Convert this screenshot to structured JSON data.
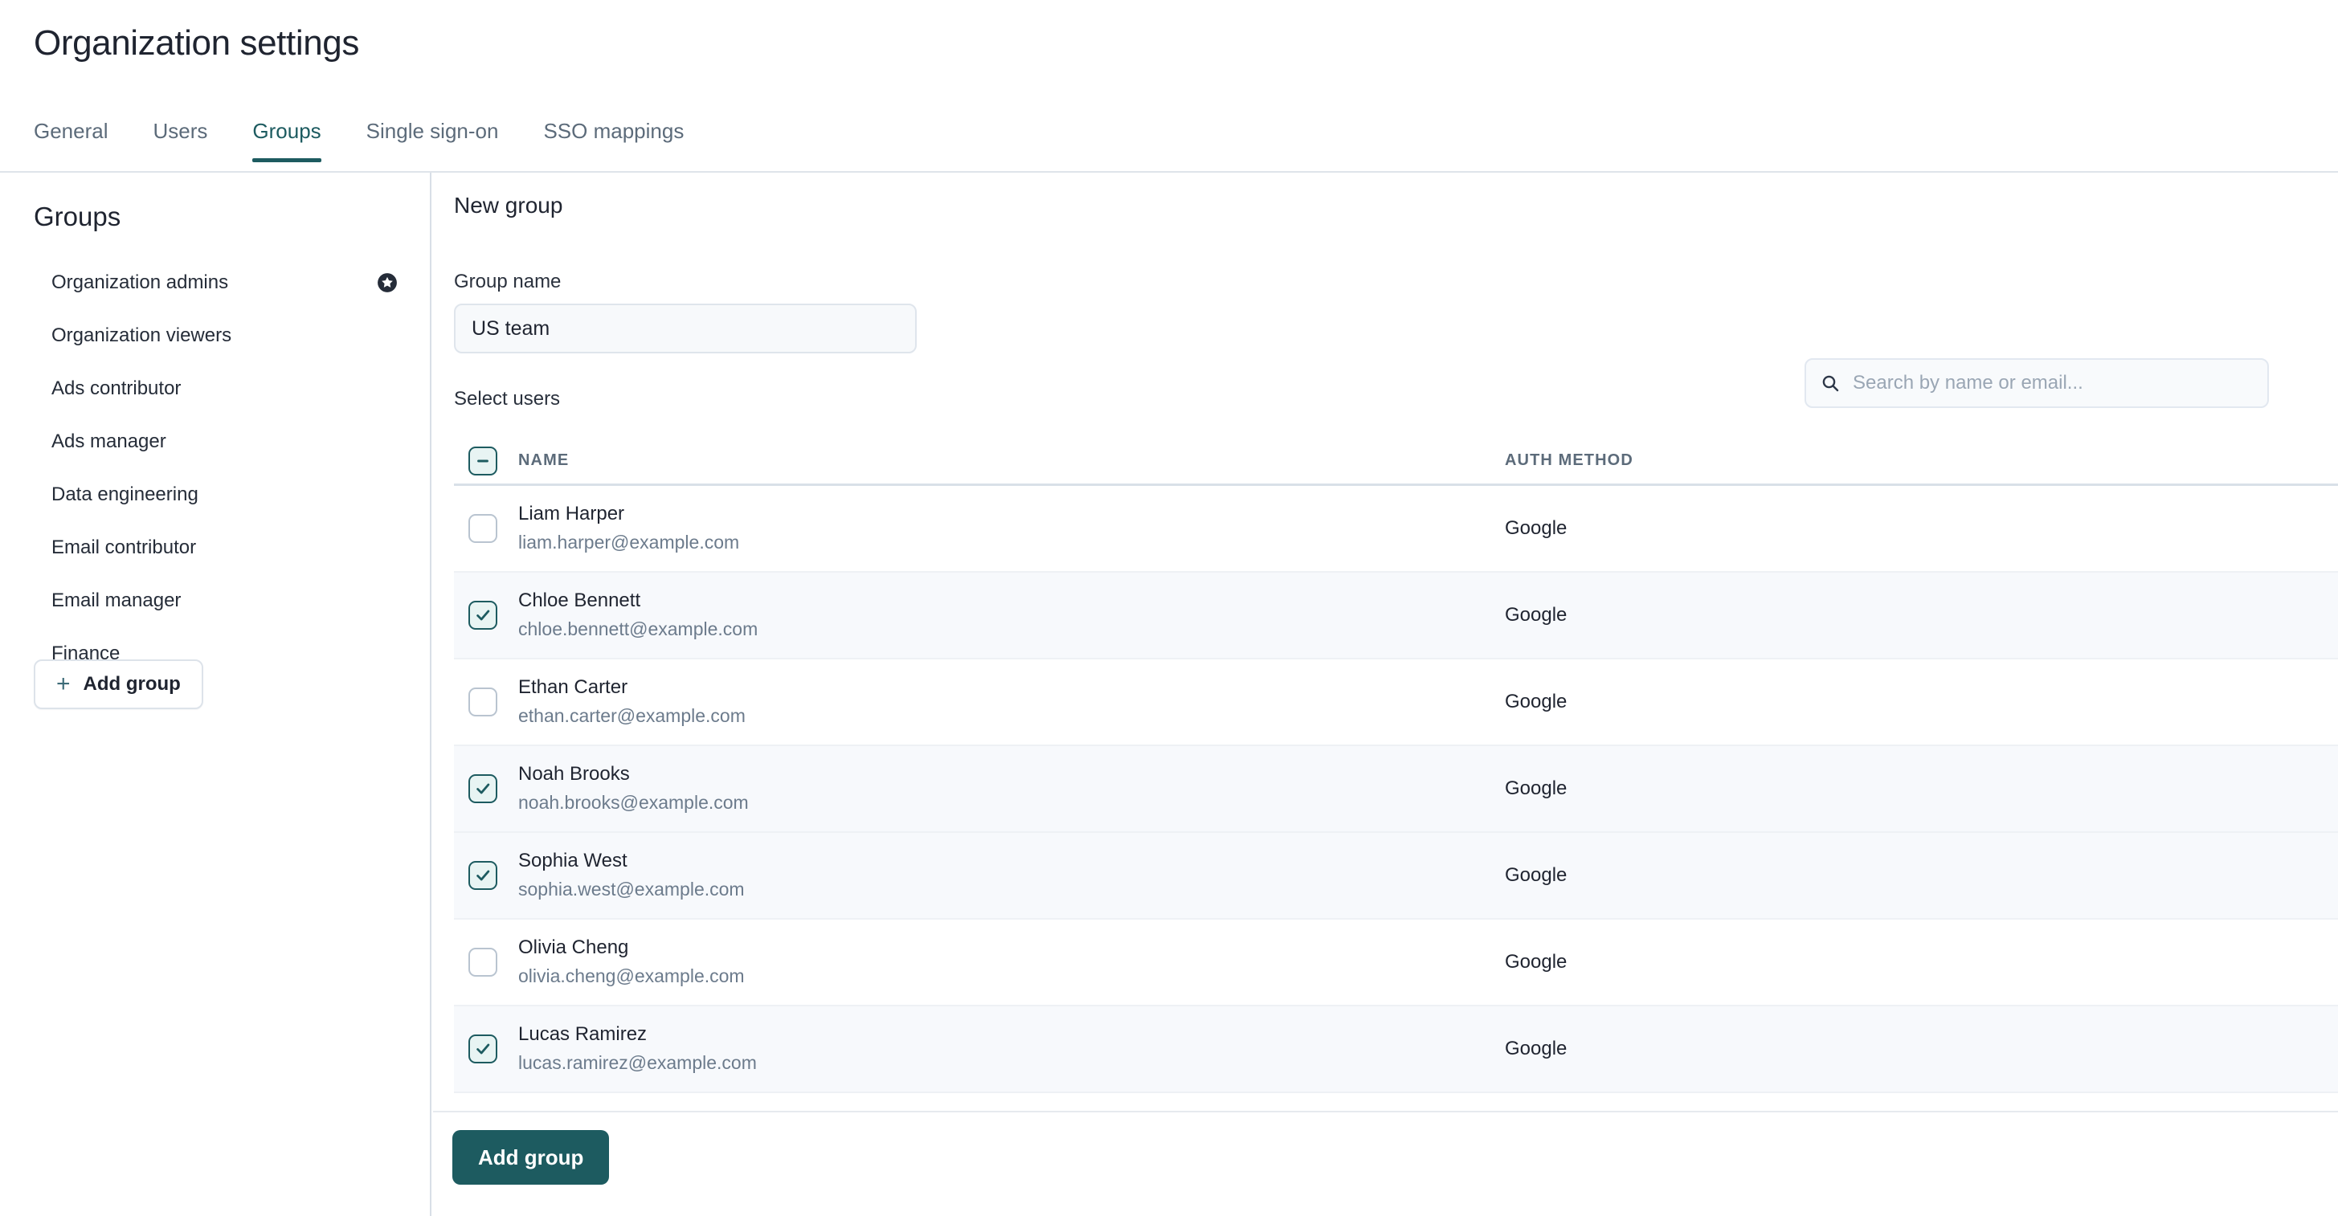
{
  "header": {
    "title": "Organization settings",
    "tabs": [
      {
        "label": "General",
        "active": false
      },
      {
        "label": "Users",
        "active": false
      },
      {
        "label": "Groups",
        "active": true
      },
      {
        "label": "Single sign-on",
        "active": false
      },
      {
        "label": "SSO mappings",
        "active": false
      }
    ]
  },
  "sidebar": {
    "title": "Groups",
    "items": [
      {
        "label": "Organization admins",
        "badge": "star-badge-icon"
      },
      {
        "label": "Organization viewers",
        "badge": null
      },
      {
        "label": "Ads contributor",
        "badge": null
      },
      {
        "label": "Ads manager",
        "badge": null
      },
      {
        "label": "Data engineering",
        "badge": null
      },
      {
        "label": "Email contributor",
        "badge": null
      },
      {
        "label": "Email manager",
        "badge": null
      },
      {
        "label": "Finance",
        "badge": null
      }
    ],
    "add_group_label": "Add group",
    "add_group_icon": "plus-icon"
  },
  "main": {
    "title": "New group",
    "group_name_label": "Group name",
    "group_name_value": "US team",
    "group_name_placeholder": "",
    "select_users_label": "Select users",
    "search": {
      "placeholder": "Search by name or email...",
      "value": "",
      "icon": "search-icon"
    },
    "table": {
      "select_all_state": "indeterminate",
      "columns": [
        "NAME",
        "AUTH METHOD"
      ],
      "rows": [
        {
          "name": "Liam Harper",
          "email": "liam.harper@example.com",
          "auth": "Google",
          "checked": false
        },
        {
          "name": "Chloe Bennett",
          "email": "chloe.bennett@example.com",
          "auth": "Google",
          "checked": true
        },
        {
          "name": "Ethan Carter",
          "email": "ethan.carter@example.com",
          "auth": "Google",
          "checked": false
        },
        {
          "name": "Noah Brooks",
          "email": "noah.brooks@example.com",
          "auth": "Google",
          "checked": true
        },
        {
          "name": "Sophia West",
          "email": "sophia.west@example.com",
          "auth": "Google",
          "checked": true
        },
        {
          "name": "Olivia Cheng",
          "email": "olivia.cheng@example.com",
          "auth": "Google",
          "checked": false
        },
        {
          "name": "Lucas Ramirez",
          "email": "lucas.ramirez@example.com",
          "auth": "Google",
          "checked": true
        }
      ]
    }
  },
  "footer": {
    "submit_label": "Add group"
  },
  "colors": {
    "accent_teal": "#1d5b60",
    "checkbox_fill": "#e8f4f3",
    "selected_row": "#f7f9fc",
    "text_primary": "#1f2430",
    "text_muted": "#6c7b8c",
    "border": "#dfe5ec"
  }
}
